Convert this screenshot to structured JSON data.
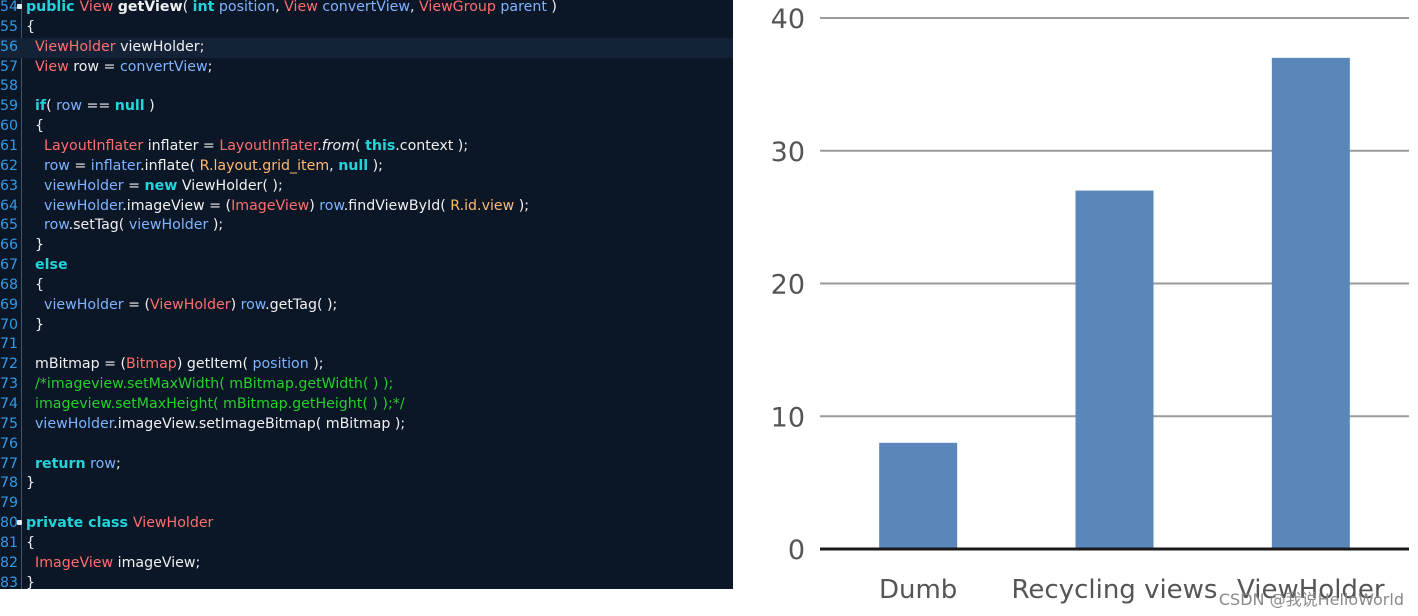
{
  "editor": {
    "current_line": 56,
    "fold_markers": [
      54,
      80
    ],
    "lines": [
      {
        "n": "54",
        "tokens": [
          {
            "t": "public View ",
            "c": "kw"
          },
          {
            "t": "",
            "c": "pl"
          }
        ]
      },
      {
        "n": "55",
        "tokens": [
          {
            "t": "{",
            "c": "pl"
          }
        ]
      },
      {
        "n": "56",
        "tokens": [
          {
            "t": "  ",
            "c": "pl"
          },
          {
            "t": "ViewHolder",
            "c": "ty"
          },
          {
            "t": " viewHolder;",
            "c": "pl"
          }
        ]
      },
      {
        "n": "57",
        "tokens": [
          {
            "t": "  ",
            "c": "pl"
          },
          {
            "t": "View",
            "c": "ty"
          },
          {
            "t": " row = ",
            "c": "pl"
          },
          {
            "t": "convertView",
            "c": "var"
          },
          {
            "t": ";",
            "c": "pl"
          }
        ]
      },
      {
        "n": "58",
        "tokens": []
      },
      {
        "n": "59",
        "tokens": [
          {
            "t": "  ",
            "c": "pl"
          },
          {
            "t": "if",
            "c": "kw"
          },
          {
            "t": "( ",
            "c": "pl"
          },
          {
            "t": "row",
            "c": "var"
          },
          {
            "t": " == ",
            "c": "pl"
          },
          {
            "t": "null",
            "c": "kw"
          },
          {
            "t": " )",
            "c": "pl"
          }
        ]
      },
      {
        "n": "60",
        "tokens": [
          {
            "t": "  {",
            "c": "pl"
          }
        ]
      },
      {
        "n": "61",
        "tokens": [
          {
            "t": "    ",
            "c": "pl"
          },
          {
            "t": "LayoutInflater",
            "c": "ty"
          },
          {
            "t": " inflater = ",
            "c": "pl"
          },
          {
            "t": "LayoutInflater",
            "c": "ty"
          },
          {
            "t": ".",
            "c": "pl"
          },
          {
            "t": "from",
            "c": "it"
          },
          {
            "t": "( ",
            "c": "pl"
          },
          {
            "t": "this",
            "c": "kw"
          },
          {
            "t": ".context );",
            "c": "pl"
          }
        ]
      },
      {
        "n": "62",
        "tokens": [
          {
            "t": "    ",
            "c": "pl"
          },
          {
            "t": "row",
            "c": "var"
          },
          {
            "t": " = ",
            "c": "pl"
          },
          {
            "t": "inflater",
            "c": "var"
          },
          {
            "t": ".inflate( ",
            "c": "pl"
          },
          {
            "t": "R.layout.",
            "c": "fld"
          },
          {
            "t": "grid_item",
            "c": "fld"
          },
          {
            "t": ", ",
            "c": "pl"
          },
          {
            "t": "null",
            "c": "kw"
          },
          {
            "t": " );",
            "c": "pl"
          }
        ]
      },
      {
        "n": "63",
        "tokens": [
          {
            "t": "    ",
            "c": "pl"
          },
          {
            "t": "viewHolder",
            "c": "var"
          },
          {
            "t": " = ",
            "c": "pl"
          },
          {
            "t": "new",
            "c": "kw"
          },
          {
            "t": " ViewHolder( );",
            "c": "pl"
          }
        ]
      },
      {
        "n": "64",
        "tokens": [
          {
            "t": "    ",
            "c": "pl"
          },
          {
            "t": "viewHolder",
            "c": "var"
          },
          {
            "t": ".imageView = (",
            "c": "pl"
          },
          {
            "t": "ImageView",
            "c": "ty"
          },
          {
            "t": ") ",
            "c": "pl"
          },
          {
            "t": "row",
            "c": "var"
          },
          {
            "t": ".findViewById( ",
            "c": "pl"
          },
          {
            "t": "R.id.",
            "c": "fld"
          },
          {
            "t": "view",
            "c": "fld"
          },
          {
            "t": " );",
            "c": "pl"
          }
        ]
      },
      {
        "n": "65",
        "tokens": [
          {
            "t": "    ",
            "c": "pl"
          },
          {
            "t": "row",
            "c": "var"
          },
          {
            "t": ".setTag( ",
            "c": "pl"
          },
          {
            "t": "viewHolder",
            "c": "var"
          },
          {
            "t": " );",
            "c": "pl"
          }
        ]
      },
      {
        "n": "66",
        "tokens": [
          {
            "t": "  }",
            "c": "pl"
          }
        ]
      },
      {
        "n": "67",
        "tokens": [
          {
            "t": "  ",
            "c": "pl"
          },
          {
            "t": "else",
            "c": "kw"
          }
        ]
      },
      {
        "n": "68",
        "tokens": [
          {
            "t": "  {",
            "c": "pl"
          }
        ]
      },
      {
        "n": "69",
        "tokens": [
          {
            "t": "    ",
            "c": "pl"
          },
          {
            "t": "viewHolder",
            "c": "var"
          },
          {
            "t": " = (",
            "c": "pl"
          },
          {
            "t": "ViewHolder",
            "c": "ty"
          },
          {
            "t": ") ",
            "c": "pl"
          },
          {
            "t": "row",
            "c": "var"
          },
          {
            "t": ".getTag( );",
            "c": "pl"
          }
        ]
      },
      {
        "n": "70",
        "tokens": [
          {
            "t": "  }",
            "c": "pl"
          }
        ]
      },
      {
        "n": "71",
        "tokens": []
      },
      {
        "n": "72",
        "tokens": [
          {
            "t": "  mBitmap = (",
            "c": "pl"
          },
          {
            "t": "Bitmap",
            "c": "ty"
          },
          {
            "t": ") getItem( ",
            "c": "pl"
          },
          {
            "t": "position",
            "c": "var"
          },
          {
            "t": " );",
            "c": "pl"
          }
        ]
      },
      {
        "n": "73",
        "tokens": [
          {
            "t": "  ",
            "c": "pl"
          },
          {
            "t": "/*imageview.setMaxWidth( mBitmap.getWidth( ) );",
            "c": "cm"
          }
        ]
      },
      {
        "n": "74",
        "tokens": [
          {
            "t": "  ",
            "c": "pl"
          },
          {
            "t": "imageview.setMaxHeight( mBitmap.getHeight( ) );*/",
            "c": "cm"
          }
        ]
      },
      {
        "n": "75",
        "tokens": [
          {
            "t": "  ",
            "c": "pl"
          },
          {
            "t": "viewHolder",
            "c": "var"
          },
          {
            "t": ".imageView.setImageBitmap( mBitmap );",
            "c": "pl"
          }
        ]
      },
      {
        "n": "76",
        "tokens": []
      },
      {
        "n": "77",
        "tokens": [
          {
            "t": "  ",
            "c": "pl"
          },
          {
            "t": "return",
            "c": "kw"
          },
          {
            "t": " ",
            "c": "pl"
          },
          {
            "t": "row",
            "c": "var"
          },
          {
            "t": ";",
            "c": "pl"
          }
        ]
      },
      {
        "n": "78",
        "tokens": [
          {
            "t": "}",
            "c": "pl"
          }
        ]
      },
      {
        "n": "79",
        "tokens": []
      },
      {
        "n": "80",
        "tokens": [
          {
            "t": "private class ",
            "c": "kw"
          },
          {
            "t": "ViewHolder",
            "c": "ty"
          }
        ]
      },
      {
        "n": "81",
        "tokens": [
          {
            "t": "{",
            "c": "pl"
          }
        ]
      },
      {
        "n": "82",
        "tokens": [
          {
            "t": "  ",
            "c": "pl"
          },
          {
            "t": "ImageView",
            "c": "ty"
          },
          {
            "t": " imageView;",
            "c": "pl"
          }
        ]
      },
      {
        "n": "83",
        "tokens": [
          {
            "t": "}",
            "c": "pl"
          }
        ]
      }
    ]
  },
  "chart_data": {
    "type": "bar",
    "categories": [
      "Dumb",
      "Recycling views",
      "ViewHolder"
    ],
    "values": [
      8,
      27,
      37
    ],
    "title": "",
    "xlabel": "",
    "ylabel": "",
    "ylim": [
      0,
      40
    ],
    "yticks": [
      "0",
      "10",
      "20",
      "30",
      "40"
    ],
    "grid": true,
    "legend": "none",
    "bar_color": "#5b86b9"
  },
  "watermark": "CSDN @我说HelloWorld"
}
